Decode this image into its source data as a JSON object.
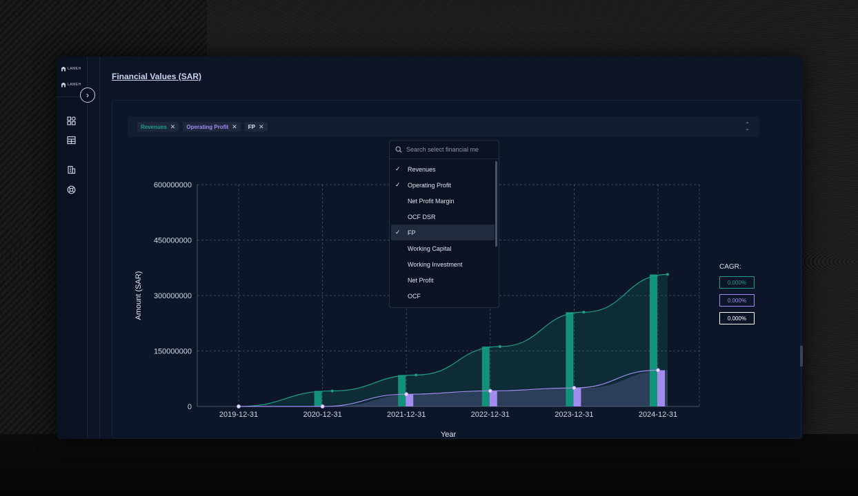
{
  "app": {
    "logo_text_1": "LAMEH",
    "logo_text_2": "LAMEH"
  },
  "page": {
    "title": "Financial Values (SAR)"
  },
  "selector": {
    "chips": [
      {
        "label": "Revenues",
        "color": "#1f9e86"
      },
      {
        "label": "Operating Profit",
        "color": "#a38bf0"
      },
      {
        "label": "FP",
        "color": "#e8ecf4"
      }
    ],
    "search_placeholder": "Search select financial me",
    "options": [
      {
        "label": "Revenues",
        "checked": true,
        "active": false
      },
      {
        "label": "Operating Profit",
        "checked": true,
        "active": false
      },
      {
        "label": "Net Profit Margin",
        "checked": false,
        "active": false
      },
      {
        "label": "OCF DSR",
        "checked": false,
        "active": false
      },
      {
        "label": "FP",
        "checked": true,
        "active": true
      },
      {
        "label": "Working Capital",
        "checked": false,
        "active": false
      },
      {
        "label": "Working Investment",
        "checked": false,
        "active": false
      },
      {
        "label": "Net Profit",
        "checked": false,
        "active": false
      },
      {
        "label": "OCF",
        "checked": false,
        "active": false
      }
    ]
  },
  "cagr": {
    "title": "CAGR:",
    "values": [
      {
        "value": "0.000%",
        "color": "#1f9e86"
      },
      {
        "value": "0.000%",
        "color": "#a38bf0"
      },
      {
        "value": "0.000%",
        "color": "#ffffff"
      }
    ]
  },
  "chart_data": {
    "type": "bar",
    "xlabel": "Year",
    "ylabel": "Amount (SAR)",
    "ylim": [
      0,
      600000000
    ],
    "yticks": [
      "0",
      "150000000",
      "300000000",
      "450000000",
      "600000000"
    ],
    "categories": [
      "2019-12-31",
      "2020-12-31",
      "2021-12-31",
      "2022-12-31",
      "2023-12-31",
      "2024-12-31"
    ],
    "grid": true,
    "series": [
      {
        "name": "Revenues",
        "color": "#13917a",
        "bars": [
          0,
          42000000,
          85000000,
          162000000,
          255000000,
          357000000
        ],
        "line": [
          0,
          42000000,
          85000000,
          162000000,
          255000000,
          357000000
        ]
      },
      {
        "name": "Operating Profit",
        "color": "#a38bf0",
        "bars": [
          0,
          0,
          33000000,
          42000000,
          50000000,
          98000000
        ],
        "line": [
          0,
          0,
          33000000,
          42000000,
          50000000,
          98000000
        ]
      }
    ]
  }
}
